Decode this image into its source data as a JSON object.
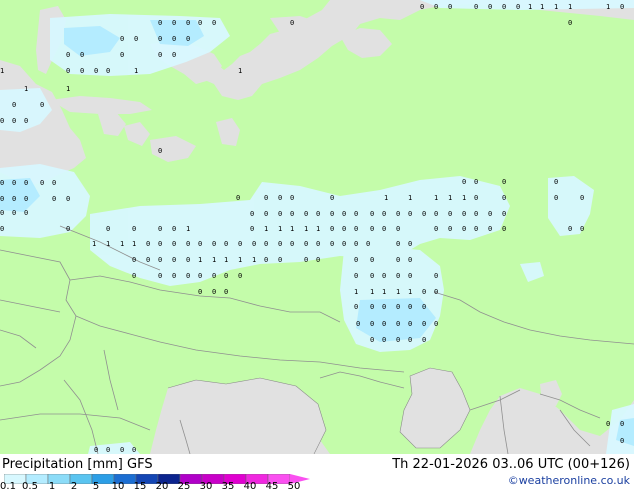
{
  "footer": {
    "title": "Precipitation [mm] GFS",
    "run": "Th 22-01-2026 03..06 UTC (00+126)",
    "credit": "©weatheronline.co.uk"
  },
  "legend": {
    "ticks": [
      "0.1",
      "0.5",
      "1",
      "2",
      "5",
      "10",
      "15",
      "20",
      "25",
      "30",
      "35",
      "40",
      "45",
      "50"
    ],
    "colors": [
      "#d8f8ff",
      "#b4ecff",
      "#8cdcf8",
      "#5ac4f0",
      "#2c9ee6",
      "#1c6ed2",
      "#1446b4",
      "#0c248e",
      "#b000c8",
      "#c800c8",
      "#e000d0",
      "#f028e0",
      "#fa50f0"
    ]
  },
  "colors": {
    "land": "#c4fcaa",
    "water": "#e1e1e1",
    "precip_light": "#d8f8ff",
    "precip_med": "#b4ecff",
    "border": "#909090"
  },
  "map": {
    "labels": [
      "0",
      "0",
      "0",
      "0",
      "0",
      "0",
      "0",
      "0",
      "0",
      "0",
      "0",
      "0",
      "0",
      "0",
      "0",
      "0",
      "0",
      "0",
      "0",
      "0",
      "1",
      "1",
      "1",
      "1",
      "1",
      "0",
      "0",
      "0",
      "0",
      "0"
    ]
  }
}
